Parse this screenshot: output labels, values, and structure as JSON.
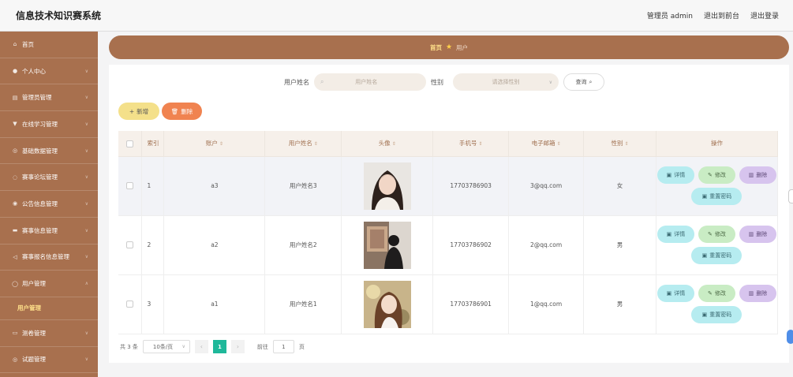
{
  "app": {
    "title": "信息技术知识赛系统"
  },
  "top_links": {
    "admin": "管理员 admin",
    "front": "退出到前台",
    "logout": "退出登录"
  },
  "sidebar": {
    "items": [
      {
        "label": "首页",
        "icon": "home-icon"
      },
      {
        "label": "个人中心",
        "icon": "user-icon"
      },
      {
        "label": "管理员管理",
        "icon": "list-icon"
      },
      {
        "label": "在线学习管理",
        "icon": "book-icon"
      },
      {
        "label": "基础数据管理",
        "icon": "database-icon"
      },
      {
        "label": "赛事论坛管理",
        "icon": "forum-icon"
      },
      {
        "label": "公告信息管理",
        "icon": "notice-icon"
      },
      {
        "label": "赛事信息管理",
        "icon": "trophy-icon"
      },
      {
        "label": "赛事报名信息管理",
        "icon": "signup-icon"
      },
      {
        "label": "用户管理",
        "icon": "users-icon"
      },
      {
        "label": "测卷管理",
        "icon": "paper-icon"
      },
      {
        "label": "试题管理",
        "icon": "question-icon"
      }
    ],
    "active_sub": "用户管理"
  },
  "breadcrumb": {
    "home": "首页",
    "current": "用户"
  },
  "search": {
    "name_label": "用户姓名",
    "name_placeholder": "用户姓名",
    "gender_label": "性别",
    "gender_placeholder": "请选择性别",
    "button": "查询"
  },
  "actions": {
    "add": "新增",
    "delete": "删除"
  },
  "table": {
    "headers": {
      "index": "索引",
      "account": "账户",
      "name": "用户姓名",
      "avatar": "头像",
      "phone": "手机号",
      "email": "电子邮箱",
      "gender": "性别",
      "ops": "操作"
    },
    "op_labels": {
      "detail": "详情",
      "edit": "修改",
      "delete": "删除",
      "reset": "重置密码"
    },
    "rows": [
      {
        "index": "1",
        "account": "a3",
        "name": "用户姓名3",
        "phone": "17703786903",
        "email": "3@qq.com",
        "gender": "女"
      },
      {
        "index": "2",
        "account": "a2",
        "name": "用户姓名2",
        "phone": "17703786902",
        "email": "2@qq.com",
        "gender": "男"
      },
      {
        "index": "3",
        "account": "a1",
        "name": "用户姓名1",
        "phone": "17703786901",
        "email": "1@qq.com",
        "gender": "男"
      }
    ]
  },
  "pagination": {
    "total": "共 3 条",
    "page_size": "10条/页",
    "current_page": "1",
    "goto_label": "前往",
    "goto_value": "1",
    "page_unit": "页"
  }
}
